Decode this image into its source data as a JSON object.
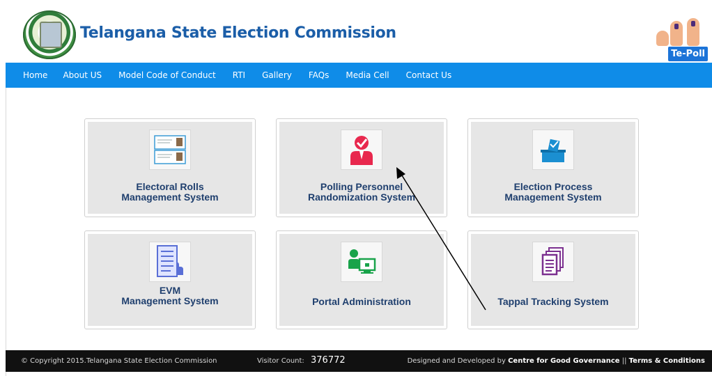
{
  "header": {
    "title": "Telangana State Election Commission",
    "logo_badge": "Te-Poll"
  },
  "nav": {
    "items": [
      "Home",
      "About US",
      "Model Code of Conduct",
      "RTI",
      "Gallery",
      "FAQs",
      "Media Cell",
      "Contact Us"
    ]
  },
  "tiles": [
    {
      "line1": "Electoral Rolls",
      "line2": "Management System",
      "icon": "voter-id-cards-icon",
      "color": "#3a9bd5"
    },
    {
      "line1": "Polling Personnel",
      "line2": "Randomization System",
      "icon": "personnel-check-icon",
      "color": "#e8284e"
    },
    {
      "line1": "Election Process",
      "line2": "Management System",
      "icon": "ballot-box-icon",
      "color": "#1b8fd1"
    },
    {
      "line1": "EVM",
      "line2": "Management System",
      "icon": "evm-checklist-icon",
      "color": "#5a6fd6"
    },
    {
      "line1": "Portal Administration",
      "line2": "",
      "icon": "admin-monitor-icon",
      "color": "#19a34a"
    },
    {
      "line1": "Tappal Tracking System",
      "line2": "",
      "icon": "documents-stack-icon",
      "color": "#7b2f8f"
    }
  ],
  "footer": {
    "copyright": "© Copyright 2015.Telangana State Election Commission",
    "visitor_label": "Visitor Count:",
    "visitor_count": "376772",
    "credit_prefix": "Designed and Developed by",
    "credit_org": "Centre for Good Governance",
    "separator": "||",
    "terms": "Terms & Conditions"
  },
  "colors": {
    "nav_bg": "#0f8ce8",
    "title": "#1b5ea8",
    "tile_text": "#1f3f6e",
    "footer_bg": "#111111"
  }
}
